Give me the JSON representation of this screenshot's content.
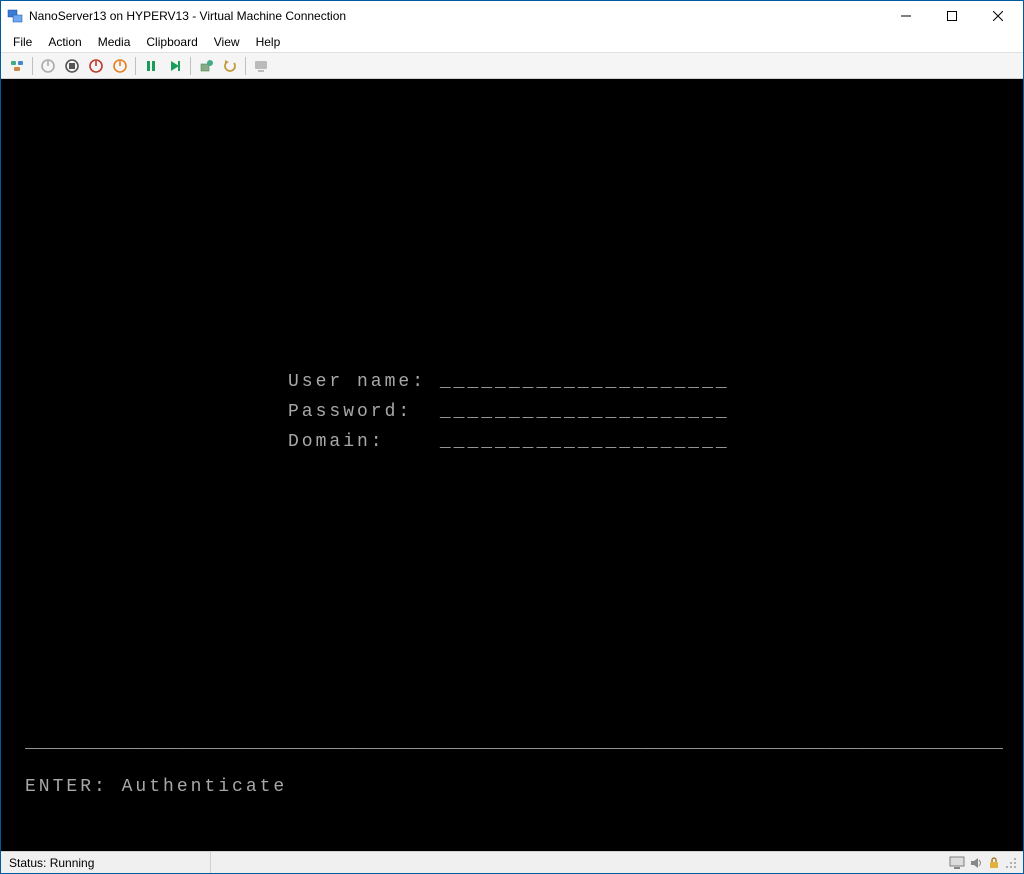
{
  "window": {
    "title": "NanoServer13 on HYPERV13 - Virtual Machine Connection"
  },
  "menu": {
    "file": "File",
    "action": "Action",
    "media": "Media",
    "clipboard": "Clipboard",
    "view": "View",
    "help": "Help"
  },
  "toolbar": {
    "icons": {
      "ctrl_alt_del": "ctrl-alt-del-icon",
      "start": "start-icon",
      "turnoff": "turnoff-icon",
      "shutdown": "shutdown-icon",
      "save": "save-icon",
      "pause": "pause-icon",
      "reset": "reset-icon",
      "checkpoint": "checkpoint-icon",
      "revert": "revert-icon",
      "enhanced": "enhanced-icon"
    }
  },
  "console": {
    "username_label": "User name:",
    "username_field": "_____________________",
    "password_label": "Password:",
    "password_field": "_____________________",
    "domain_label": "Domain:",
    "domain_field": "_____________________",
    "divider": "__________________________________________________________________________________________________",
    "auth_hint": "ENTER: Authenticate"
  },
  "status": {
    "text": "Status: Running"
  }
}
